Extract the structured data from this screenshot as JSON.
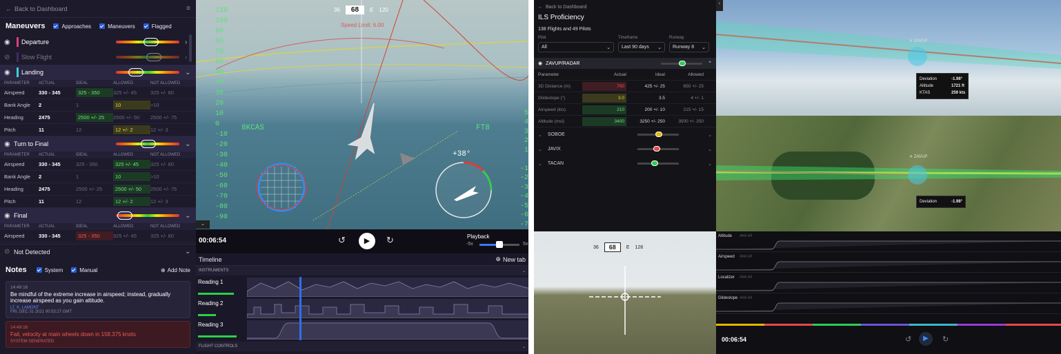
{
  "left": {
    "back": "Back to Dashboard",
    "maneuvers_title": "Maneuvers",
    "filters": [
      "Approaches",
      "Maneuvers",
      "Flagged"
    ],
    "maneuvers": [
      {
        "name": "Departure",
        "color": "#e33b7a"
      },
      {
        "name": "Slow Flight",
        "color": "#6d3fa8"
      },
      {
        "name": "Landing",
        "color": "#3fd0d8"
      }
    ],
    "cols": [
      "PARAMETER",
      "ACTUAL",
      "IDEAL",
      "ALLOWED",
      "NOT ALLOWED"
    ],
    "landing_rows": [
      [
        "Airspeed",
        "330 - 345",
        "325 - 350",
        "325 +/- 45",
        "325 +/- 80"
      ],
      [
        "Bank Angle",
        "2",
        "1",
        "10",
        ">10"
      ],
      [
        "Heading",
        "2475",
        "2500 +/- 25",
        "2500 +/- 50",
        "2500 +/- 75"
      ],
      [
        "Pitch",
        "11",
        "12",
        "12 +/- 2",
        "12 +/- 3"
      ]
    ],
    "turn_title": "Turn to Final",
    "turn_rows": [
      [
        "Airspeed",
        "330 - 345",
        "325 - 350",
        "325 +/- 45",
        "325 +/- 80"
      ],
      [
        "Bank Angle",
        "2",
        "1",
        "10",
        ">10"
      ],
      [
        "Heading",
        "2475",
        "2500 +/- 25",
        "2500 +/- 50",
        "2500 +/- 75"
      ],
      [
        "Pitch",
        "11",
        "12",
        "12 +/- 2",
        "12 +/- 3"
      ]
    ],
    "final_title": "Final",
    "final_rows": [
      [
        "Airspeed",
        "330 - 345",
        "325 - 350",
        "325 +/- 45",
        "325 +/- 80"
      ]
    ],
    "not_detected": "Not Detected",
    "notes_title": "Notes",
    "notes_filters": [
      "System",
      "Manual"
    ],
    "add_note": "Add Note",
    "note1": {
      "time": "14:49:16",
      "text": "Be mindful of the extreme increase in airspeed; instead, gradually increase airspeed as you gain altitude.",
      "by": "LT. K. LAMONT",
      "date": "FRI, DEC 31 2021 00:53:27 GMT"
    },
    "note2": {
      "time": "14:49:16",
      "text": "Fail, velocity at main wheels down in 158.375 knots",
      "by": "SYSTEM GENERATED"
    },
    "hud": {
      "compass": [
        "36",
        "68",
        "E",
        "120"
      ],
      "kcas": "8KCAS",
      "ft": "FT8",
      "angle": "+38°",
      "warning": "Speed Limit: 6.00"
    },
    "time": "00:06:54",
    "playback": "Playback",
    "speed_min": "-5x",
    "speed_max": "5x",
    "playback_level": 0.5,
    "timeline": "Timeline",
    "new_tab": "New tab",
    "instruments": "INSTRUMENTS",
    "readings": [
      "Reading 1",
      "Reading 2",
      "Reading 3"
    ],
    "flight_controls": "FLIGHT CONTROLS"
  },
  "right": {
    "back": "Back to Dashboard",
    "title": "ILS Proficiency",
    "subtitle": "138 Flights and 49 Pilots",
    "selects": [
      {
        "label": "Pilot",
        "value": "All"
      },
      {
        "label": "Timeframe",
        "value": "Last 90 days"
      },
      {
        "label": "Runway",
        "value": "Runway 8"
      }
    ],
    "section": "ZAVUP/RADAR",
    "cols": [
      "Parameter",
      "Actual",
      "Ideal",
      "Allowed"
    ],
    "rows": [
      [
        "3D Distance (m)",
        "700",
        "425 +/- 25",
        "650 +/- 25"
      ],
      [
        "Glideslope (°)",
        "3.0",
        "3.5",
        "4 +/- 1"
      ],
      [
        "Airspeed (kts)",
        "210",
        "200 +/- 10",
        "215 +/- 15"
      ],
      [
        "Altitude (msl)",
        "3400",
        "3250 +/- 250",
        "3500 +/- 250"
      ]
    ],
    "subs": [
      "SOBOE",
      "JAVIX",
      "TACAN"
    ],
    "zavup": "ZAVUP",
    "tip1": [
      [
        "Deviation",
        "-1.98°"
      ],
      [
        "Altitude",
        "1721 ft"
      ],
      [
        "KTAS",
        "259 kts"
      ]
    ],
    "tip2": [
      [
        "Deviation",
        "-1.98°"
      ]
    ],
    "graph_labels": [
      "Altitude",
      "Airspeed",
      "Localizer",
      "Glideslope"
    ],
    "placeholder": "###.##",
    "time": "00:06:54",
    "compass": [
      "36",
      "68",
      "E",
      "128"
    ]
  }
}
